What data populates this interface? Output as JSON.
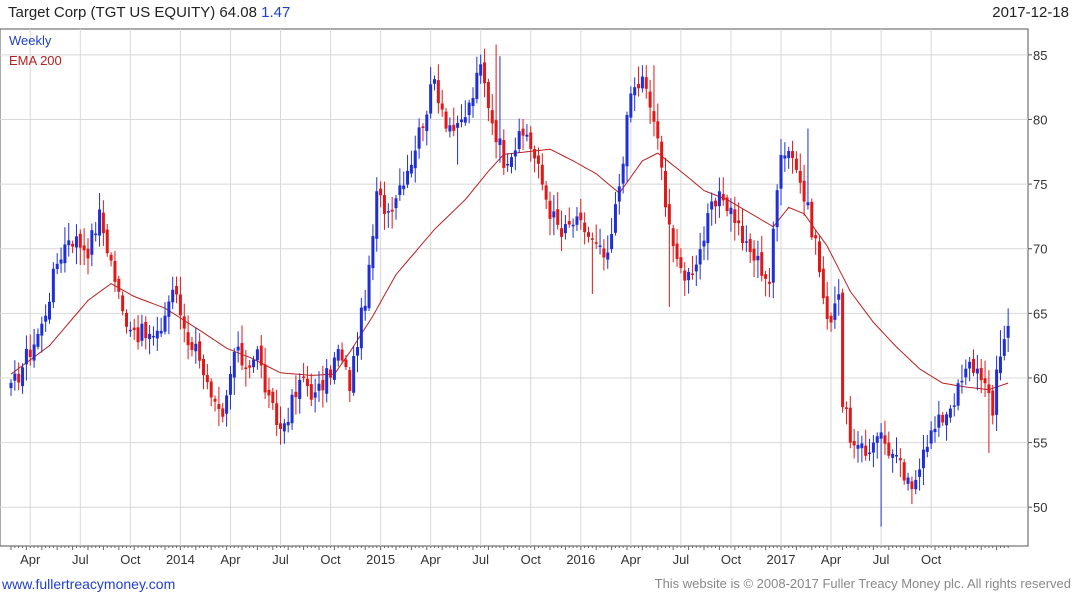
{
  "header": {
    "title": "Target Corp (TGT US EQUITY) 64.08",
    "change": "1.47",
    "date": "2017-12-18"
  },
  "footer": {
    "site": "www.fullertreacymoney.com",
    "copyright": "This website is © 2008-2017 Fuller Treacy Money plc. All rights reserved"
  },
  "colors": {
    "up": "#1f2fd6",
    "down": "#e01818",
    "ema": "#b82020",
    "grid": "#d8d8d8"
  },
  "chart_data": {
    "type": "candlestick",
    "frequency": "Weekly",
    "legend": [
      {
        "label": "Weekly",
        "color": "#1f3fd0"
      },
      {
        "label": "EMA 200",
        "color": "#b82020"
      }
    ],
    "ylim": [
      47,
      87
    ],
    "y_ticks": [
      50,
      55,
      60,
      65,
      70,
      75,
      80,
      85
    ],
    "x_ticks": [
      {
        "week": 5,
        "label": "Apr"
      },
      {
        "week": 18,
        "label": "Jul"
      },
      {
        "week": 31,
        "label": "Oct"
      },
      {
        "week": 44,
        "label": "2014"
      },
      {
        "week": 57,
        "label": "Apr"
      },
      {
        "week": 70,
        "label": "Jul"
      },
      {
        "week": 83,
        "label": "Oct"
      },
      {
        "week": 96,
        "label": "2015"
      },
      {
        "week": 109,
        "label": "Apr"
      },
      {
        "week": 122,
        "label": "Jul"
      },
      {
        "week": 135,
        "label": "Oct"
      },
      {
        "week": 148,
        "label": "2016"
      },
      {
        "week": 161,
        "label": "Apr"
      },
      {
        "week": 174,
        "label": "Jul"
      },
      {
        "week": 187,
        "label": "Oct"
      },
      {
        "week": 200,
        "label": "2017"
      },
      {
        "week": 213,
        "label": "Apr"
      },
      {
        "week": 226,
        "label": "Jul"
      },
      {
        "week": 239,
        "label": "Oct"
      }
    ],
    "close_anchors": [
      [
        0,
        59
      ],
      [
        3,
        61
      ],
      [
        8,
        64
      ],
      [
        12,
        69
      ],
      [
        15,
        71
      ],
      [
        20,
        70
      ],
      [
        23,
        72.5
      ],
      [
        26,
        69
      ],
      [
        29,
        65
      ],
      [
        33,
        63.5
      ],
      [
        38,
        63
      ],
      [
        42,
        67
      ],
      [
        46,
        63
      ],
      [
        49,
        62
      ],
      [
        52,
        58
      ],
      [
        55,
        56.5
      ],
      [
        58,
        62
      ],
      [
        61,
        61
      ],
      [
        64,
        62
      ],
      [
        67,
        58
      ],
      [
        70,
        56
      ],
      [
        73,
        58
      ],
      [
        76,
        60
      ],
      [
        79,
        58.5
      ],
      [
        82,
        60
      ],
      [
        85,
        62
      ],
      [
        88,
        59.5
      ],
      [
        90,
        63
      ],
      [
        93,
        68
      ],
      [
        95,
        74
      ],
      [
        98,
        73
      ],
      [
        101,
        75
      ],
      [
        104,
        77
      ],
      [
        107,
        80
      ],
      [
        110,
        83
      ],
      [
        113,
        80
      ],
      [
        116,
        79
      ],
      [
        119,
        81
      ],
      [
        122,
        84
      ],
      [
        125,
        80
      ],
      [
        128,
        77
      ],
      [
        131,
        78
      ],
      [
        134,
        79
      ],
      [
        137,
        76
      ],
      [
        140,
        73
      ],
      [
        143,
        71
      ],
      [
        146,
        72
      ],
      [
        149,
        71.5
      ],
      [
        152,
        70
      ],
      [
        155,
        69
      ],
      [
        158,
        75
      ],
      [
        161,
        82
      ],
      [
        164,
        83
      ],
      [
        167,
        80
      ],
      [
        170,
        74
      ],
      [
        173,
        68.5
      ],
      [
        176,
        68
      ],
      [
        179,
        70
      ],
      [
        182,
        73
      ],
      [
        185,
        74
      ],
      [
        188,
        72.5
      ],
      [
        191,
        70
      ],
      [
        194,
        69
      ],
      [
        197,
        67.5
      ],
      [
        200,
        78
      ],
      [
        203,
        77.5
      ],
      [
        206,
        74
      ],
      [
        209,
        70.5
      ],
      [
        212,
        64
      ],
      [
        215,
        67
      ],
      [
        216,
        58
      ],
      [
        219,
        54.5
      ],
      [
        222,
        54
      ],
      [
        225,
        56
      ],
      [
        228,
        54.5
      ],
      [
        231,
        53
      ],
      [
        234,
        51
      ],
      [
        237,
        55
      ],
      [
        240,
        56
      ],
      [
        243,
        57.5
      ],
      [
        246,
        59
      ],
      [
        249,
        61
      ],
      [
        252,
        60.5
      ],
      [
        255,
        57
      ],
      [
        256,
        61
      ],
      [
        259,
        64
      ]
    ],
    "ema_200": [
      [
        0,
        60.3
      ],
      [
        10,
        62.5
      ],
      [
        20,
        66.0
      ],
      [
        26,
        67.3
      ],
      [
        32,
        66.3
      ],
      [
        40,
        65.4
      ],
      [
        50,
        63.5
      ],
      [
        56,
        62.3
      ],
      [
        62,
        61.6
      ],
      [
        70,
        60.4
      ],
      [
        78,
        60.2
      ],
      [
        84,
        60.3
      ],
      [
        88,
        62.0
      ],
      [
        94,
        64.8
      ],
      [
        100,
        68.0
      ],
      [
        110,
        71.5
      ],
      [
        118,
        73.8
      ],
      [
        124,
        76.0
      ],
      [
        128,
        77.3
      ],
      [
        134,
        77.5
      ],
      [
        140,
        77.7
      ],
      [
        146,
        76.8
      ],
      [
        152,
        75.8
      ],
      [
        158,
        74.3
      ],
      [
        164,
        76.8
      ],
      [
        168,
        77.4
      ],
      [
        176,
        75.5
      ],
      [
        180,
        74.5
      ],
      [
        186,
        73.8
      ],
      [
        194,
        72.4
      ],
      [
        198,
        71.7
      ],
      [
        202,
        73.2
      ],
      [
        206,
        72.7
      ],
      [
        212,
        70.2
      ],
      [
        218,
        66.7
      ],
      [
        224,
        64.3
      ],
      [
        230,
        62.4
      ],
      [
        236,
        60.7
      ],
      [
        242,
        59.6
      ],
      [
        248,
        59.3
      ],
      [
        254,
        59.1
      ],
      [
        259,
        59.6
      ]
    ],
    "low_anchors": [
      [
        116,
        76.5
      ],
      [
        151,
        66.5
      ],
      [
        171,
        65.5
      ],
      [
        226,
        48.5
      ],
      [
        239,
        54.5
      ],
      [
        254,
        54.2
      ]
    ],
    "high_anchors": [
      [
        126,
        85.8
      ],
      [
        127,
        84.9
      ],
      [
        164,
        84.2
      ],
      [
        167,
        84.2
      ],
      [
        207,
        79.3
      ],
      [
        257,
        63.7
      ]
    ]
  }
}
